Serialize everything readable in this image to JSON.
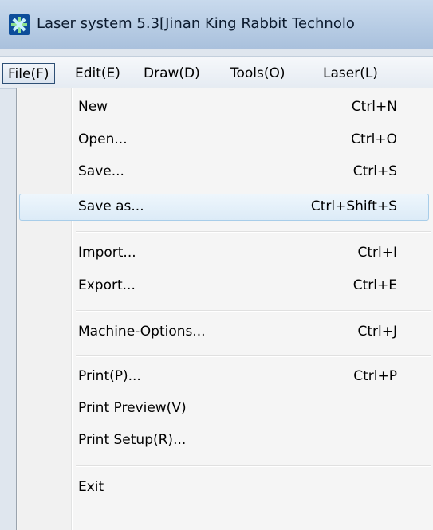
{
  "window": {
    "title": "Laser system 5.3[Jinan King Rabbit Technolo",
    "icon": "app-logo-icon"
  },
  "menubar": {
    "items": [
      {
        "label": "File(F)",
        "active": true
      },
      {
        "label": "Edit(E)",
        "active": false
      },
      {
        "label": "Draw(D)",
        "active": false
      },
      {
        "label": "Tools(O)",
        "active": false
      },
      {
        "label": "Laser(L)",
        "active": false
      }
    ]
  },
  "file_menu": {
    "items": [
      {
        "label": "New",
        "shortcut": "Ctrl+N"
      },
      {
        "label": "Open...",
        "shortcut": "Ctrl+O"
      },
      {
        "label": "Save...",
        "shortcut": "Ctrl+S"
      },
      {
        "label": "Save as...",
        "shortcut": "Ctrl+Shift+S",
        "highlighted": true
      },
      {
        "label": "Import...",
        "shortcut": "Ctrl+I"
      },
      {
        "label": "Export...",
        "shortcut": "Ctrl+E"
      },
      {
        "label": "Machine-Options...",
        "shortcut": "Ctrl+J"
      },
      {
        "label": "Print(P)...",
        "shortcut": "Ctrl+P"
      },
      {
        "label": "Print Preview(V)",
        "shortcut": ""
      },
      {
        "label": "Print Setup(R)...",
        "shortcut": ""
      },
      {
        "label": "Exit",
        "shortcut": ""
      }
    ]
  },
  "colors": {
    "highlight_fill": "#dcebf7",
    "highlight_border": "#a8cde9",
    "menu_background": "#f5f5f5",
    "titlebar": "#b7cce4"
  }
}
